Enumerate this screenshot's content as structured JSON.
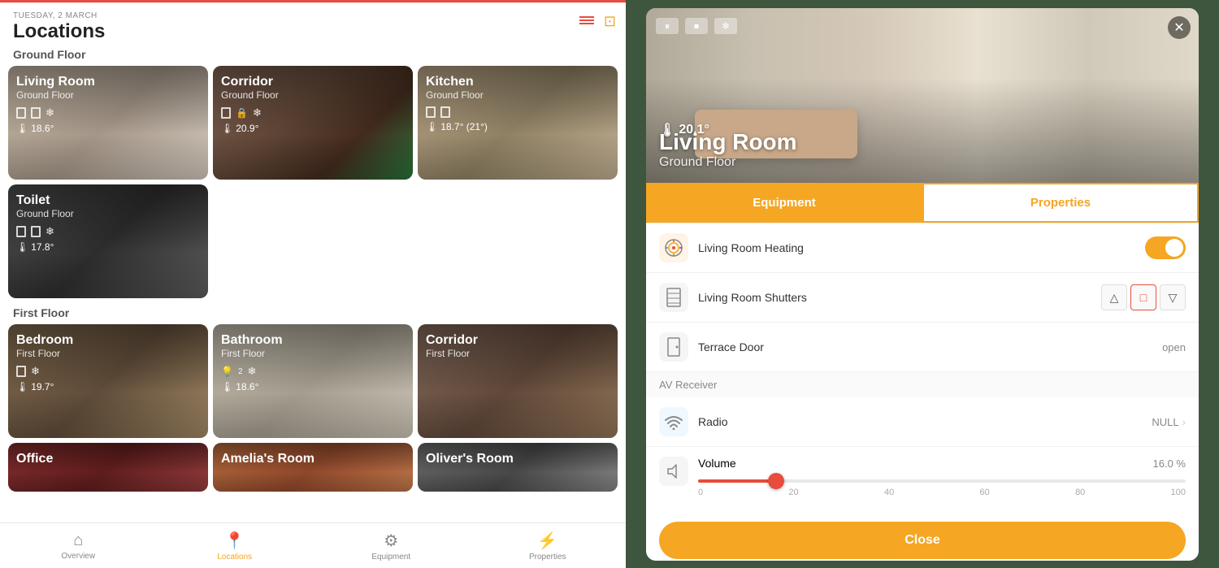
{
  "app": {
    "date": "TUESDAY, 2 MARCH",
    "title": "Locations"
  },
  "nav": {
    "items": [
      {
        "id": "overview",
        "label": "Overview",
        "icon": "⌂",
        "active": false
      },
      {
        "id": "locations",
        "label": "Locations",
        "icon": "📍",
        "active": true
      },
      {
        "id": "equipment",
        "label": "Equipment",
        "icon": "⚙",
        "active": false
      },
      {
        "id": "properties",
        "label": "Properties",
        "icon": "⚡",
        "active": false
      }
    ]
  },
  "sections": [
    {
      "id": "ground-floor",
      "label": "Ground Floor",
      "rooms": [
        {
          "id": "living-room",
          "name": "Living Room",
          "floor": "Ground Floor",
          "temp": "18.6°",
          "bg": "bg-living",
          "icons": [
            "shutter",
            "shutter",
            "snow"
          ]
        },
        {
          "id": "corridor-ground",
          "name": "Corridor",
          "floor": "Ground Floor",
          "temp": "20.9°",
          "bg": "bg-corridor",
          "icons": [
            "shutter",
            "lock",
            "snow"
          ]
        },
        {
          "id": "kitchen",
          "name": "Kitchen",
          "floor": "Ground Floor",
          "temp": "18.7° (21°)",
          "bg": "bg-kitchen",
          "icons": [
            "shutter",
            "shutter"
          ]
        }
      ]
    },
    {
      "id": "ground-floor-row2",
      "label": "",
      "rooms": [
        {
          "id": "toilet",
          "name": "Toilet",
          "floor": "Ground Floor",
          "temp": "17.8°",
          "bg": "bg-toilet",
          "icons": [
            "shutter",
            "shutter",
            "snow"
          ]
        },
        {
          "id": "empty1",
          "name": "",
          "floor": "",
          "temp": "",
          "bg": "",
          "icons": []
        },
        {
          "id": "empty2",
          "name": "",
          "floor": "",
          "temp": "",
          "bg": "",
          "icons": []
        }
      ]
    },
    {
      "id": "first-floor",
      "label": "First Floor",
      "rooms": [
        {
          "id": "bedroom",
          "name": "Bedroom",
          "floor": "First Floor",
          "temp": "19.7°",
          "bg": "bg-bedroom",
          "icons": [
            "shutter",
            "snow"
          ]
        },
        {
          "id": "bathroom",
          "name": "Bathroom",
          "floor": "First Floor",
          "temp": "18.6°",
          "bg": "bg-bathroom",
          "icons": [
            "light2",
            "snow"
          ]
        },
        {
          "id": "corridor-first",
          "name": "Corridor",
          "floor": "First Floor",
          "temp": "",
          "bg": "bg-corridor2",
          "icons": []
        }
      ]
    },
    {
      "id": "first-floor-row2",
      "label": "",
      "rooms": [
        {
          "id": "office",
          "name": "Office",
          "floor": "First Floor",
          "temp": "",
          "bg": "bg-office",
          "icons": []
        },
        {
          "id": "amelia",
          "name": "Amelia's Room",
          "floor": "First Floor",
          "temp": "",
          "bg": "bg-amelia",
          "icons": []
        },
        {
          "id": "oliver",
          "name": "Oliver's Room",
          "floor": "First Floor",
          "temp": "",
          "bg": "bg-oliver",
          "icons": []
        }
      ]
    }
  ],
  "detail": {
    "room_name": "Living Room",
    "room_floor": "Ground Floor",
    "temp": "20.1°",
    "close_label": "✕",
    "tabs": [
      {
        "id": "equipment",
        "label": "Equipment",
        "active": true
      },
      {
        "id": "properties",
        "label": "Properties",
        "active": false
      }
    ],
    "equipment_items": [
      {
        "id": "heating",
        "name": "Living Room Heating",
        "type": "toggle",
        "value": "on",
        "icon": "🌡"
      },
      {
        "id": "shutters",
        "name": "Living Room Shutters",
        "type": "shutter-control",
        "value": "",
        "icon": "▣"
      },
      {
        "id": "terrace-door",
        "name": "Terrace Door",
        "type": "text",
        "value": "open",
        "icon": "🚪"
      }
    ],
    "av_section": "AV Receiver",
    "av_items": [
      {
        "id": "radio",
        "name": "Radio",
        "type": "text",
        "value": "NULL",
        "icon": "📶"
      },
      {
        "id": "volume",
        "name": "Volume",
        "type": "slider",
        "value": "16.0 %",
        "min": 0,
        "max": 100,
        "current": 16,
        "icon": "🔇"
      }
    ],
    "slider_labels": [
      "0",
      "20",
      "40",
      "60",
      "80",
      "100"
    ],
    "close_button_label": "Close"
  },
  "colors": {
    "orange": "#f5a623",
    "red": "#e74c3c",
    "active_nav": "#f5a623"
  }
}
